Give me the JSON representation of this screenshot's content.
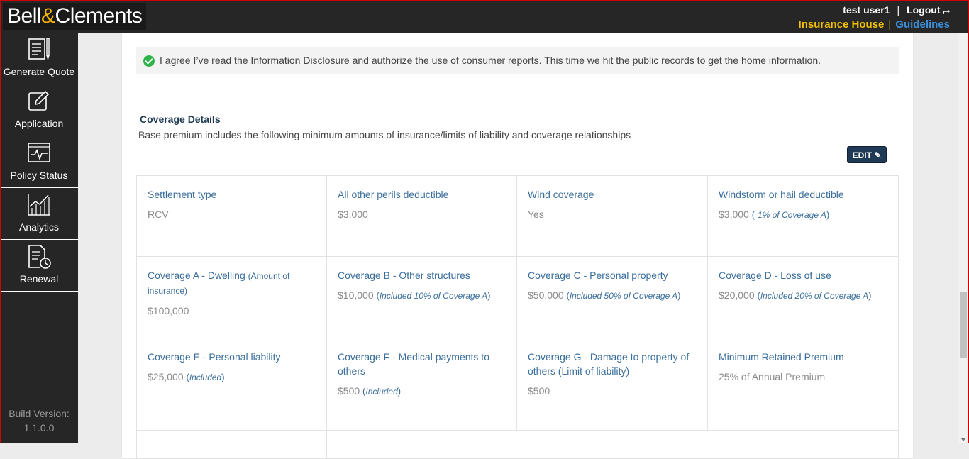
{
  "header": {
    "logo_left": "Bell",
    "logo_amp": "&",
    "logo_right": "Clements",
    "user": "test user1",
    "separator": "|",
    "logout": "Logout",
    "insurance_house": "Insurance House",
    "guidelines": "Guidelines"
  },
  "sidebar": {
    "items": [
      {
        "label": "Generate Quote",
        "icon": "document-pen-icon"
      },
      {
        "label": "Application",
        "icon": "edit-icon"
      },
      {
        "label": "Policy Status",
        "icon": "pulse-monitor-icon"
      },
      {
        "label": "Analytics",
        "icon": "line-chart-icon"
      },
      {
        "label": "Renewal",
        "icon": "document-clock-icon"
      }
    ],
    "build_label": "Build Version:",
    "build_version": "1.1.0.0"
  },
  "agreement": {
    "text": "I agree I’ve read the Information Disclosure and authorize the use of consumer reports. This time we hit the public records to get the home information."
  },
  "coverage": {
    "title": "Coverage Details",
    "subtitle": "Base premium includes the following minimum amounts of insurance/limits of liability and coverage relationships",
    "edit_label": "EDIT",
    "cells": [
      {
        "label": "Settlement type",
        "value": "RCV"
      },
      {
        "label": "All other perils deductible",
        "value": "$3,000"
      },
      {
        "label": "Wind coverage",
        "value": "Yes"
      },
      {
        "label": "Windstorm or hail deductible",
        "value": "$3,000",
        "note_open": "(",
        "note": "1% of Coverage A",
        "note_close": ")"
      },
      {
        "label": "Coverage A - Dwelling",
        "label_note": "(Amount of insurance)",
        "value": "$100,000"
      },
      {
        "label": "Coverage B - Other structures",
        "value": "$10,000",
        "note_open": "(",
        "note": "Included 10% of Coverage A",
        "note_close": ")"
      },
      {
        "label": "Coverage C - Personal property",
        "value": "$50,000",
        "note_open": "(",
        "note": "Included 50% of Coverage A",
        "note_close": ")"
      },
      {
        "label": "Coverage D - Loss of use",
        "value": "$20,000",
        "note_open": "(",
        "note": "Included 20% of Coverage A",
        "note_close": ")"
      },
      {
        "label": "Coverage E - Personal liability",
        "value": "$25,000",
        "note_open": "(",
        "note": "Included",
        "note_close": ")"
      },
      {
        "label": "Coverage F - Medical payments to others",
        "value": "$500",
        "note_open": "(",
        "note": "Included",
        "note_close": ")"
      },
      {
        "label": "Coverage G - Damage to property of others (Limit of liability)",
        "value": "$500"
      },
      {
        "label": "Minimum Retained Premium",
        "value": "25% of Annual Premium"
      }
    ]
  }
}
